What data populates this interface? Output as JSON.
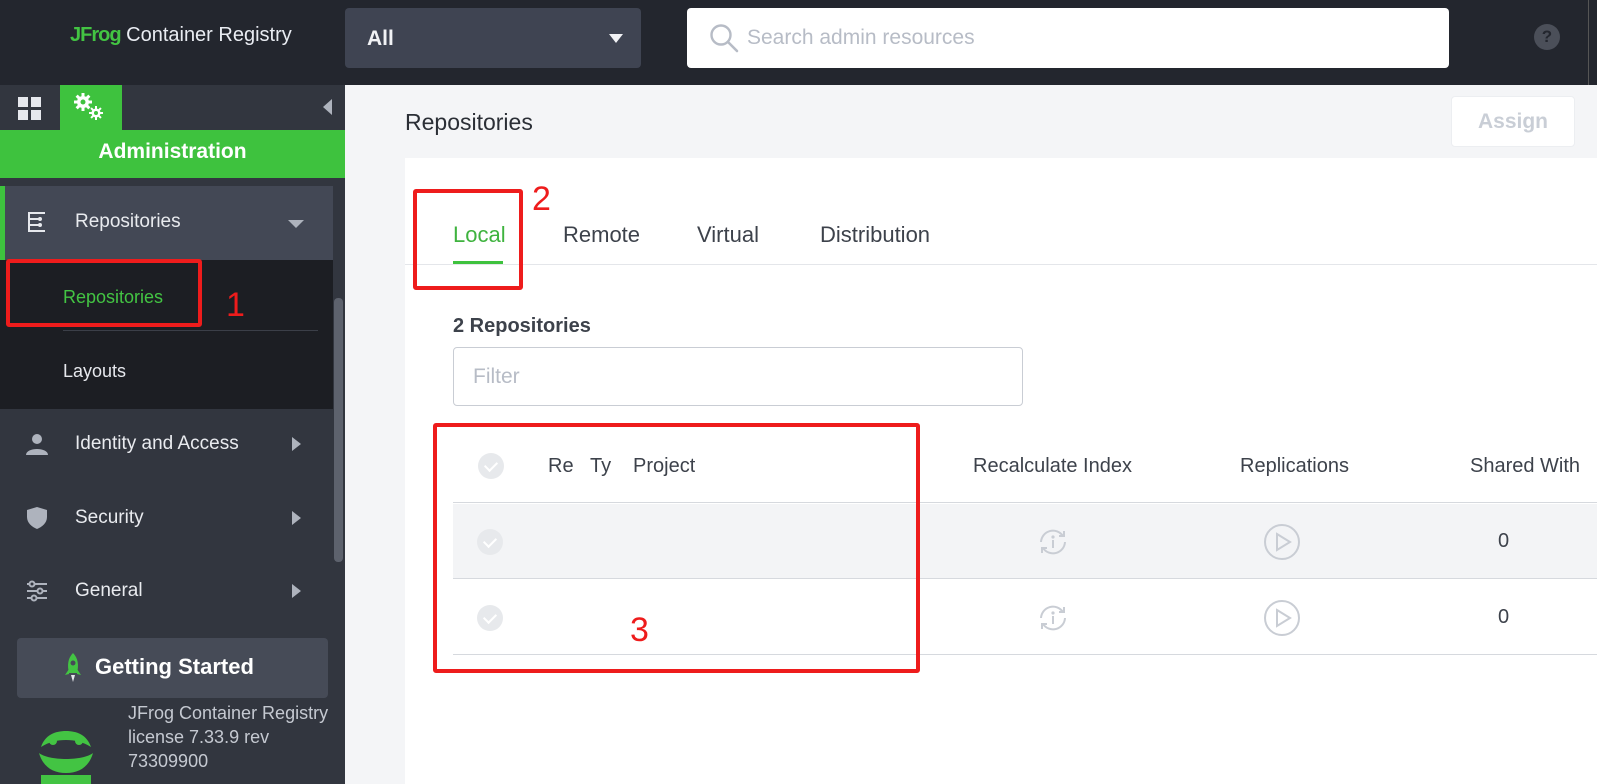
{
  "header": {
    "brand_prefix": "JFrog",
    "brand_name": "Container Registry",
    "scope_value": "All",
    "search_placeholder": "Search admin resources",
    "help_label": "?"
  },
  "sidebar": {
    "section_title": "Administration",
    "items": [
      {
        "label": "Repositories",
        "icon": "repositories-icon",
        "expanded": true
      },
      {
        "label": "Identity and Access",
        "icon": "user-icon"
      },
      {
        "label": "Security",
        "icon": "shield-icon"
      },
      {
        "label": "General",
        "icon": "sliders-icon"
      }
    ],
    "sub_items": [
      {
        "label": "Repositories",
        "selected": true
      },
      {
        "label": "Layouts"
      }
    ],
    "getting_started": "Getting Started",
    "license_text": "JFrog Container Registry license 7.33.9 rev 73309900"
  },
  "main": {
    "page_title": "Repositories",
    "assign_label": "Assign",
    "tabs": [
      {
        "label": "Local",
        "active": true
      },
      {
        "label": "Remote"
      },
      {
        "label": "Virtual"
      },
      {
        "label": "Distribution"
      }
    ],
    "repo_count": "2 Repositories",
    "filter_placeholder": "Filter",
    "columns": [
      "Re",
      "Ty",
      "Project",
      "Recalculate Index",
      "Replications",
      "Shared With"
    ],
    "rows": [
      {
        "shared_with": "0"
      },
      {
        "shared_with": "0"
      }
    ]
  },
  "annotations": [
    "1",
    "2",
    "3"
  ],
  "colors": {
    "accent_green": "#3ec23e",
    "topbar_bg": "#23262e",
    "sidebar_bg": "#32363f",
    "annotation_red": "#ee1c1c"
  }
}
